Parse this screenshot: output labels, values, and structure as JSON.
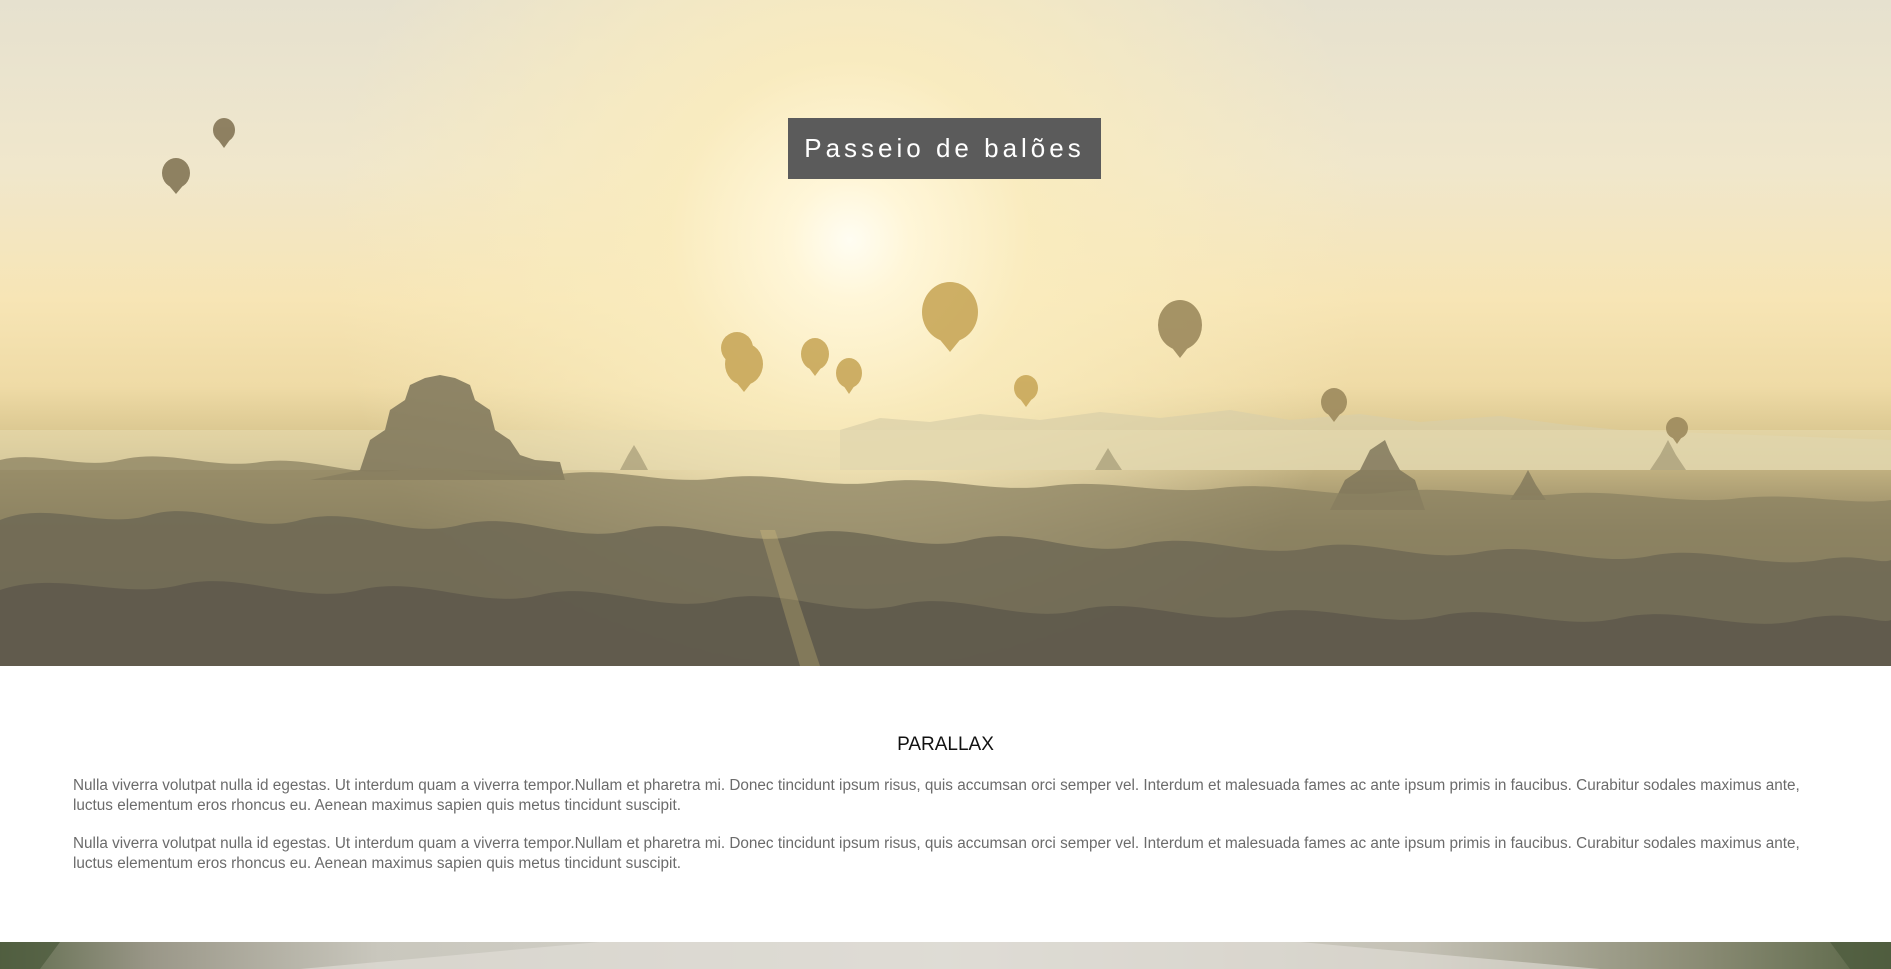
{
  "hero": {
    "title": "Passeio de balões",
    "image_icon": "hot-air-balloons-landscape-image"
  },
  "section": {
    "heading": "PARALLAX",
    "paragraphs": [
      "Nulla viverra volutpat nulla id egestas. Ut interdum quam a viverra tempor.Nullam et pharetra mi. Donec tincidunt ipsum risus, quis accumsan orci semper vel. Interdum et malesuada fames ac ante ipsum primis in faucibus. Curabitur sodales maximus ante, luctus elementum eros rhoncus eu. Aenean maximus sapien quis metus tincidunt suscipit.",
      "Nulla viverra volutpat nulla id egestas. Ut interdum quam a viverra tempor.Nullam et pharetra mi. Donec tincidunt ipsum risus, quis accumsan orci semper vel. Interdum et malesuada fames ac ante ipsum primis in faucibus. Curabitur sodales maximus ante, luctus elementum eros rhoncus eu. Aenean maximus sapien quis metus tincidunt suscipit."
    ]
  },
  "footer": {
    "image_icon": "road-landscape-image"
  },
  "colors": {
    "title_bg": "#5b5b5b",
    "title_text": "#ffffff",
    "heading_text": "#111111",
    "body_text": "#6b6b6b"
  }
}
